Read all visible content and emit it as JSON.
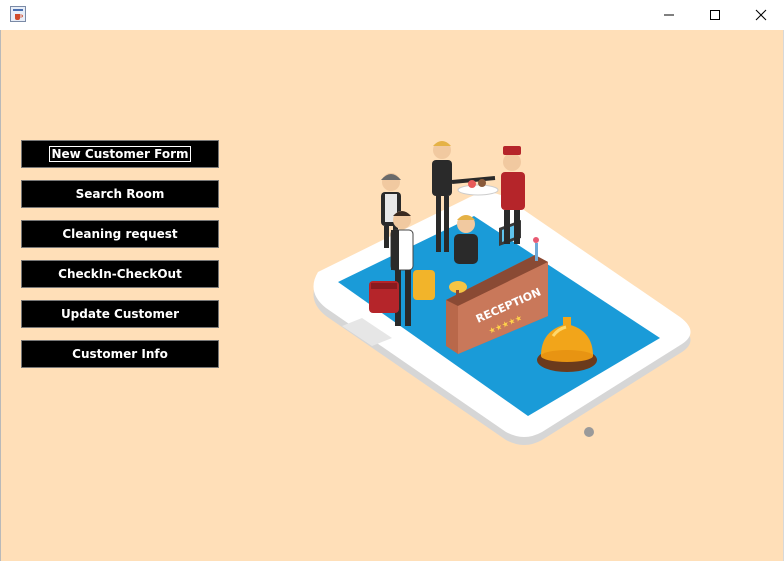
{
  "window": {
    "icon": "java-coffee-icon",
    "controls": [
      "minimize-icon",
      "maximize-icon",
      "close-icon"
    ]
  },
  "menu": [
    {
      "label": "New Customer Form",
      "focused": true
    },
    {
      "label": "Search Room"
    },
    {
      "label": "Cleaning request"
    },
    {
      "label": "CheckIn-CheckOut"
    },
    {
      "label": "Update Customer"
    },
    {
      "label": "Customer Info"
    }
  ],
  "illustration": {
    "sign": "RECEPTION"
  },
  "colors": {
    "background": "#ffdfb8",
    "button": "#000000",
    "phone_screen": "#1a9bd8"
  }
}
